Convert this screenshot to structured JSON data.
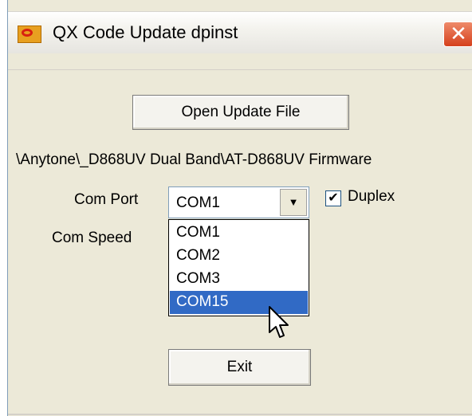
{
  "window": {
    "title": "QX Code Update dpinst",
    "close_glyph": "✕"
  },
  "buttons": {
    "open_update_file": "Open Update File",
    "exit": "Exit"
  },
  "file_path": "\\Anytone\\_D868UV Dual Band\\AT-D868UV  Firmware",
  "com_port": {
    "label": "Com Port",
    "selected": "COM1",
    "options": [
      "COM1",
      "COM2",
      "COM3",
      "COM15"
    ],
    "highlighted": "COM15"
  },
  "com_speed": {
    "label": "Com Speed"
  },
  "duplex": {
    "label": "Duplex",
    "checked": true
  },
  "icons": {
    "app_icon": "qx-app-icon",
    "close_icon": "close-icon",
    "dropdown_arrow": "chevron-down-icon",
    "cursor": "mouse-pointer-icon"
  },
  "colors": {
    "selection": "#316ac5",
    "close_button": "#d5401c",
    "dialog_background": "#ece9d8"
  }
}
